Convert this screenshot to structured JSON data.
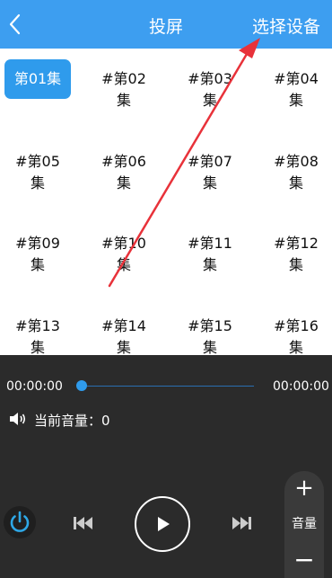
{
  "header": {
    "back_icon": "chevron-left-icon",
    "title": "投屏",
    "select_device": "选择设备"
  },
  "colors": {
    "accent": "#2f9bec",
    "header_bg": "#3d9ef0",
    "player_bg": "#2b2b2b",
    "power": "#2ea7e6"
  },
  "episodes": [
    {
      "num": "第01集",
      "label": ""
    },
    {
      "num": "#第02",
      "label": "集"
    },
    {
      "num": "#第03",
      "label": "集"
    },
    {
      "num": "#第04",
      "label": "集"
    },
    {
      "num": "#第05",
      "label": "集"
    },
    {
      "num": "#第06",
      "label": "集"
    },
    {
      "num": "#第07",
      "label": "集"
    },
    {
      "num": "#第08",
      "label": "集"
    },
    {
      "num": "#第09",
      "label": "集"
    },
    {
      "num": "#第10",
      "label": "集"
    },
    {
      "num": "#第11",
      "label": "集"
    },
    {
      "num": "#第12",
      "label": "集"
    },
    {
      "num": "#第13",
      "label": "集"
    },
    {
      "num": "#第14",
      "label": "集"
    },
    {
      "num": "#第15",
      "label": "集"
    },
    {
      "num": "#第16",
      "label": "集"
    }
  ],
  "player": {
    "current_time": "00:00:00",
    "total_time": "00:00:00",
    "progress": 0,
    "volume_text": "当前音量：0",
    "speaker_icon": "speaker-icon",
    "power_icon": "power-icon",
    "prev_icon": "skip-previous-icon",
    "play_icon": "play-icon",
    "next_icon": "skip-next-icon",
    "volume_panel": {
      "plus": "+",
      "label": "音量",
      "minus": "−"
    }
  }
}
